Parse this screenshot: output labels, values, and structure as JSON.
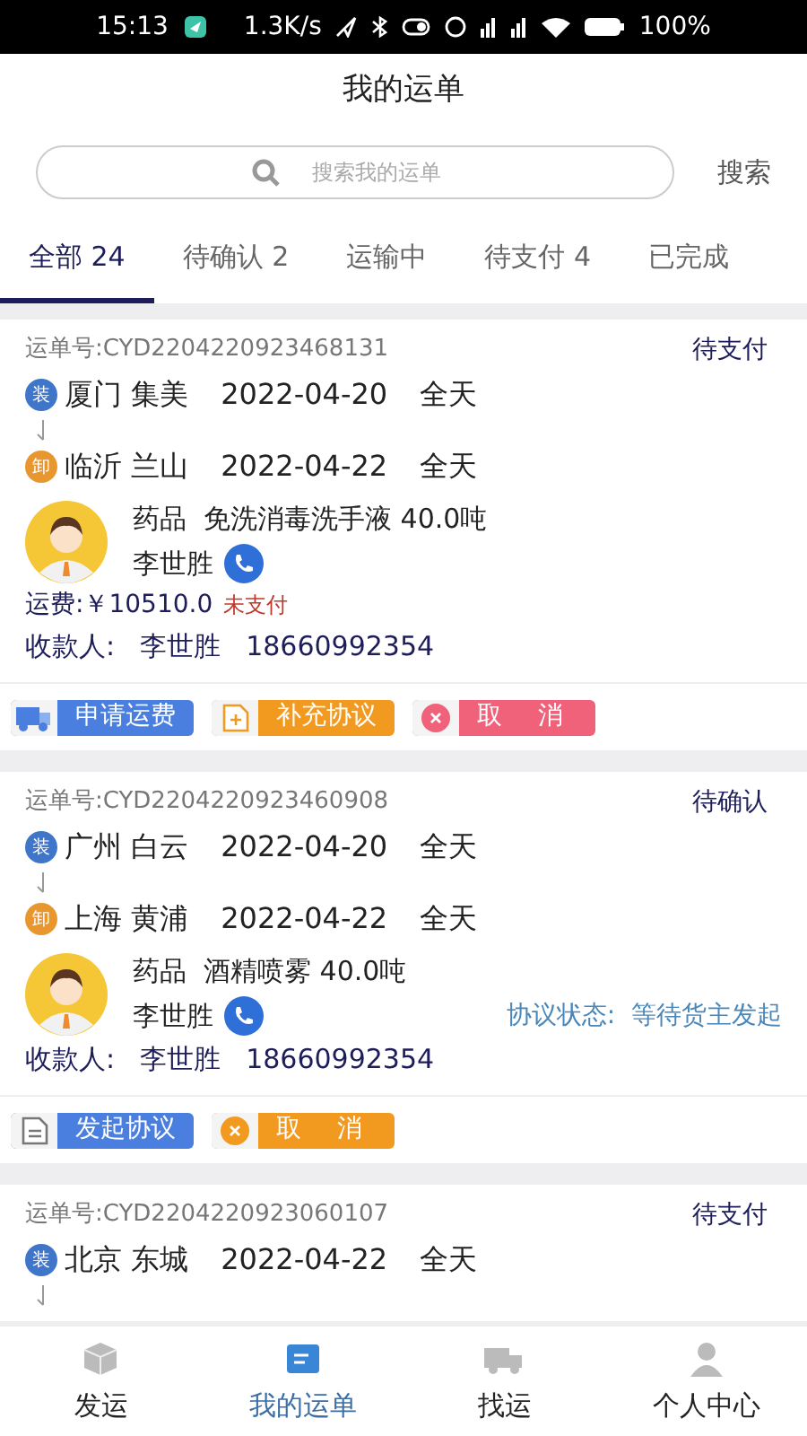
{
  "status_bar": {
    "time": "15:13",
    "speed": "1.3K/s",
    "battery": "100%"
  },
  "title": "我的运单",
  "search": {
    "placeholder": "搜索我的运单",
    "button": "搜索"
  },
  "tabs": [
    {
      "label": "全部 24",
      "selected": true
    },
    {
      "label": "待确认 2",
      "selected": false
    },
    {
      "label": "运输中",
      "selected": false
    },
    {
      "label": "待支付 4",
      "selected": false
    },
    {
      "label": "已完成",
      "selected": false
    }
  ],
  "orders": [
    {
      "order_no": "运单号:CYD2204220923468131",
      "status": "待支付",
      "load_tag": "装",
      "load": "厦门 集美",
      "load_date": "2022-04-20",
      "load_time": "全天",
      "unload_tag": "卸",
      "unload": "临沂 兰山",
      "unload_date": "2022-04-22",
      "unload_time": "全天",
      "goods": "药品  免洗消毒洗手液 40.0吨",
      "driver": "李世胜",
      "fare": "运费:￥10510.0",
      "fare_status": "未支付",
      "payee_label": "收款人:",
      "payee": "李世胜",
      "phone": "18660992354",
      "actions": [
        {
          "label": "申请运费",
          "kind": "truck",
          "color": "#4a7fe0"
        },
        {
          "label": "补充协议",
          "kind": "doc-plus",
          "color": "#f29a1f"
        },
        {
          "label": "取 消",
          "kind": "cancel",
          "color": "#f0617a"
        }
      ]
    },
    {
      "order_no": "运单号:CYD2204220923460908",
      "status": "待确认",
      "load_tag": "装",
      "load": "广州 白云",
      "load_date": "2022-04-20",
      "load_time": "全天",
      "unload_tag": "卸",
      "unload": "上海 黄浦",
      "unload_date": "2022-04-22",
      "unload_time": "全天",
      "goods": "药品  酒精喷雾 40.0吨",
      "driver": "李世胜",
      "agreement": "协议状态:  等待货主发起",
      "payee_label": "收款人:",
      "payee": "李世胜",
      "phone": "18660992354",
      "actions": [
        {
          "label": "发起协议",
          "kind": "doc",
          "color": "#4a7fe0"
        },
        {
          "label": "取 消",
          "kind": "cancel",
          "color": "#f29a1f"
        }
      ]
    },
    {
      "order_no": "运单号:CYD2204220923060107",
      "status": "待支付",
      "load_tag": "装",
      "load": "北京 东城",
      "load_date": "2022-04-22",
      "load_time": "全天"
    }
  ],
  "nav": [
    {
      "label": "发运",
      "kind": "box",
      "selected": false
    },
    {
      "label": "我的运单",
      "kind": "list",
      "selected": true
    },
    {
      "label": "找运",
      "kind": "truck",
      "selected": false
    },
    {
      "label": "个人中心",
      "kind": "person",
      "selected": false
    }
  ]
}
